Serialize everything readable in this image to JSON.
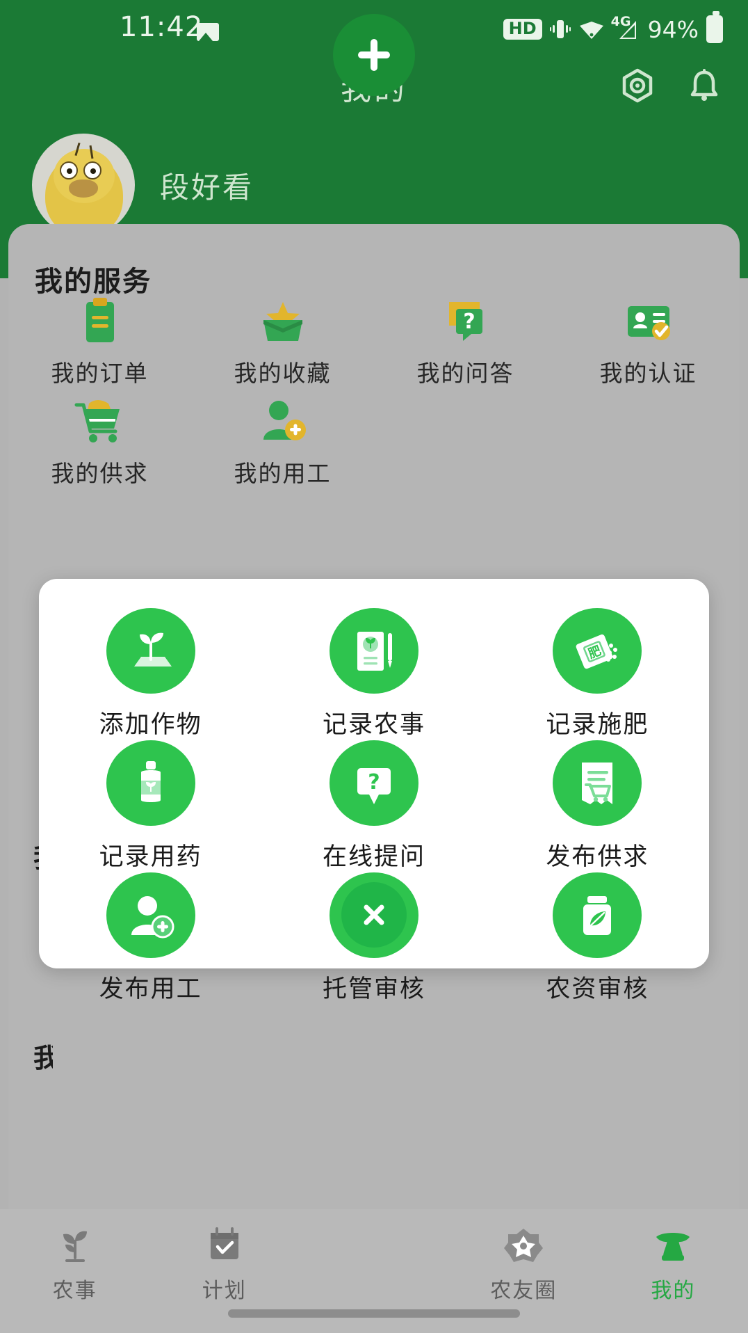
{
  "status_bar": {
    "time": "11:42",
    "photo_icon": "photo-icon",
    "hd_label": "HD",
    "vibrate_icon": "vibrate-icon",
    "wifi_icon": "wifi-icon",
    "network_label": "4G",
    "battery_percent": "94%",
    "battery_icon": "battery-icon"
  },
  "header": {
    "title": "我的",
    "settings_icon": "settings-hexagon-icon",
    "bell_icon": "bell-icon",
    "user_name": "段好看",
    "avatar_icon": "duck-avatar",
    "background_color": "#1b7a35"
  },
  "services": {
    "section_title": "我的服务",
    "items": [
      {
        "label": "我的订单",
        "icon": "clipboard-icon"
      },
      {
        "label": "我的收藏",
        "icon": "star-box-icon"
      },
      {
        "label": "我的问答",
        "icon": "question-bubble-icon"
      },
      {
        "label": "我的认证",
        "icon": "id-card-check-icon"
      },
      {
        "label": "我的供求",
        "icon": "shopping-cart-icon"
      },
      {
        "label": "我的用工",
        "icon": "person-plus-icon"
      }
    ]
  },
  "background_peek": {
    "line1": "我",
    "line2": "我"
  },
  "modal": {
    "accent_color": "#2ec44e",
    "close_icon": "close-x-icon",
    "items": [
      {
        "label": "添加作物",
        "icon": "sprout-field-icon"
      },
      {
        "label": "记录农事",
        "icon": "notebook-pencil-icon"
      },
      {
        "label": "记录施肥",
        "icon": "fertilizer-bag-icon"
      },
      {
        "label": "记录用药",
        "icon": "medicine-bottle-icon"
      },
      {
        "label": "在线提问",
        "icon": "question-bubble-icon"
      },
      {
        "label": "发布供求",
        "icon": "document-cart-icon"
      },
      {
        "label": "发布用工",
        "icon": "person-plus-icon"
      },
      {
        "label": "托管审核",
        "icon": "house-in-hand-icon"
      },
      {
        "label": "农资审核",
        "icon": "jar-leaf-icon"
      }
    ]
  },
  "bottom_nav": {
    "active_color": "#25a843",
    "fab_icon": "plus-icon",
    "tabs": [
      {
        "label": "农事",
        "icon": "plant-icon",
        "active": false
      },
      {
        "label": "计划",
        "icon": "calendar-check-icon",
        "active": false
      },
      {
        "label": "农友圈",
        "icon": "flower-circle-icon",
        "active": false
      },
      {
        "label": "我的",
        "icon": "person-icon",
        "active": true
      }
    ]
  }
}
